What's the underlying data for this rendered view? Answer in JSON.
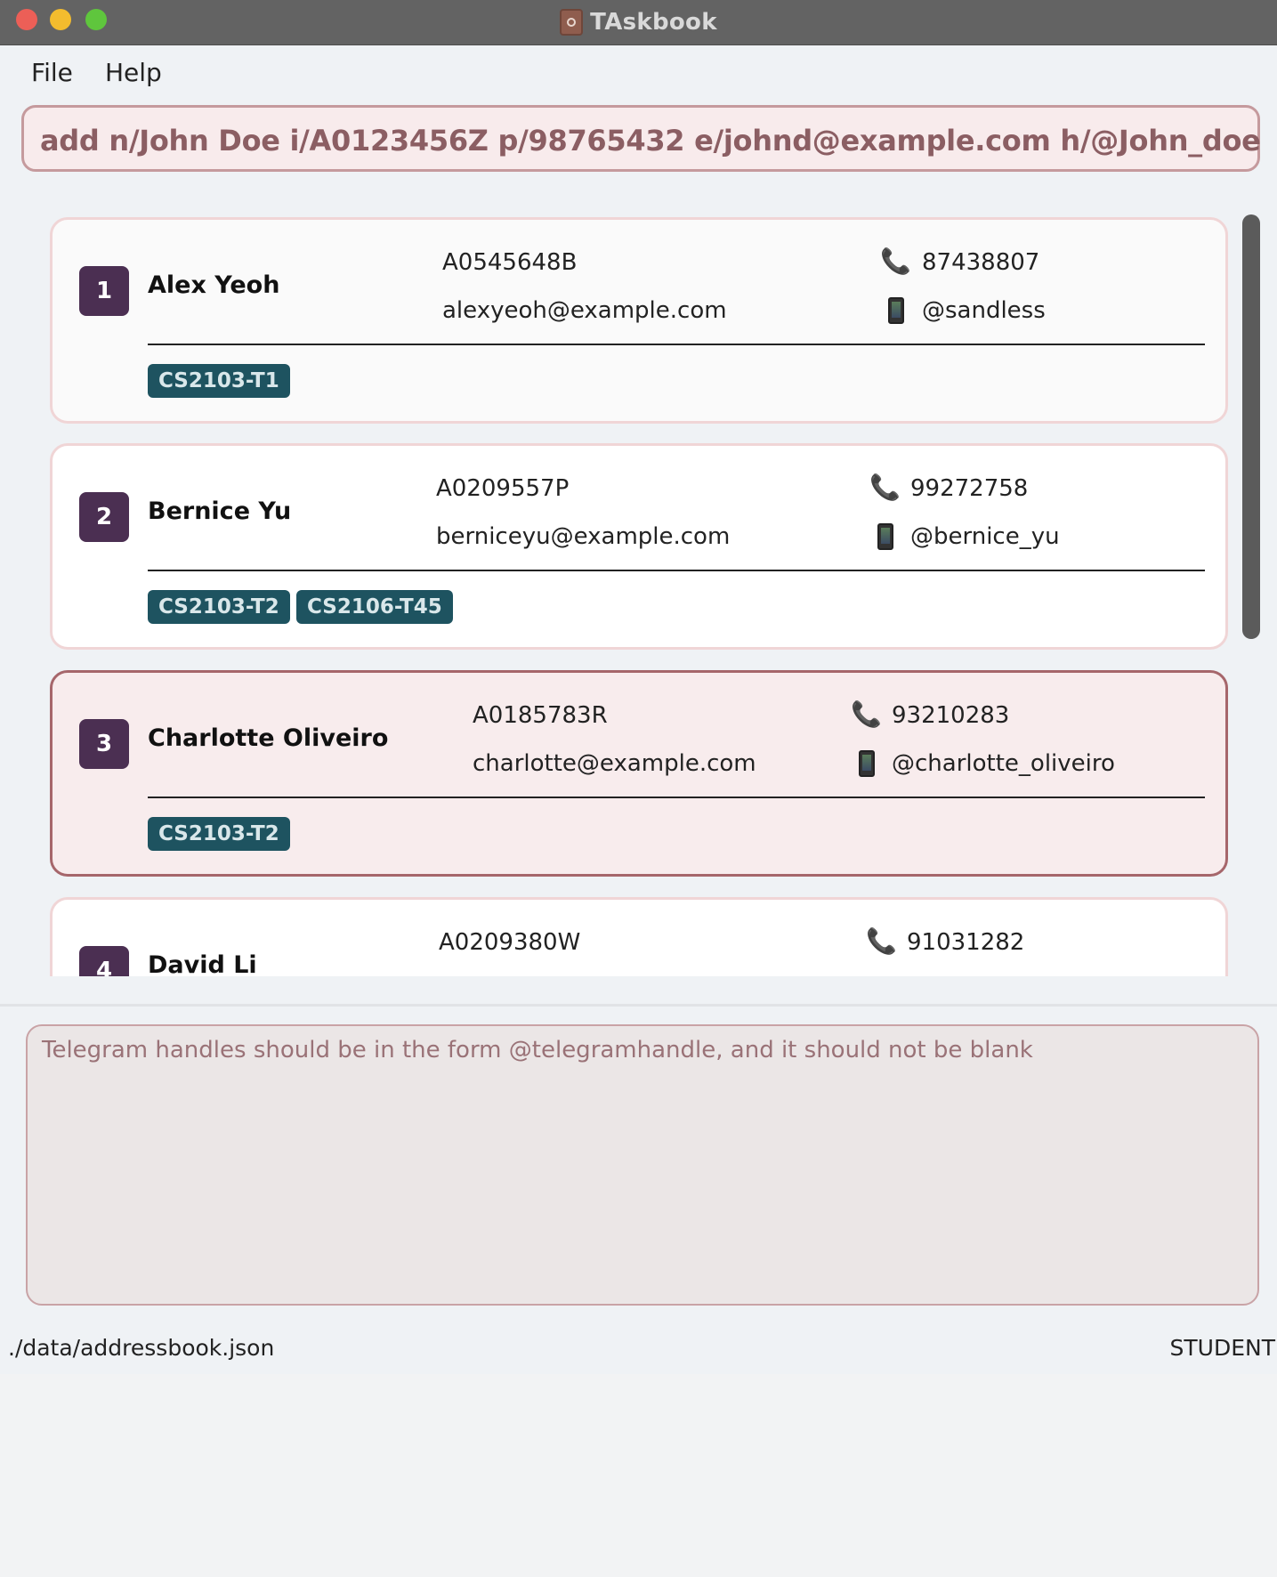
{
  "window": {
    "title": "TAskbook"
  },
  "menu": {
    "file": "File",
    "help": "Help"
  },
  "command": {
    "text": "add n/John Doe i/A0123456Z p/98765432 e/johnd@example.com h/@John_doe"
  },
  "persons": [
    {
      "index": "1",
      "name": "Alex Yeoh",
      "id": "A0545648B",
      "email": "alexyeoh@example.com",
      "phone": "87438807",
      "telegram": "@sandless",
      "tags": [
        "CS2103-T1"
      ]
    },
    {
      "index": "2",
      "name": "Bernice Yu",
      "id": "A0209557P",
      "email": "berniceyu@example.com",
      "phone": "99272758",
      "telegram": "@bernice_yu",
      "tags": [
        "CS2103-T2",
        "CS2106-T45"
      ]
    },
    {
      "index": "3",
      "name": "Charlotte Oliveiro",
      "id": "A0185783R",
      "email": "charlotte@example.com",
      "phone": "93210283",
      "telegram": "@charlotte_oliveiro",
      "tags": [
        "CS2103-T2"
      ]
    },
    {
      "index": "4",
      "name": "David Li",
      "id": "A0209380W",
      "phone": "91031282"
    }
  ],
  "result": {
    "text": "Telegram handles should be in the form @telegramhandle, and it should not be blank"
  },
  "status": {
    "file_path": "./data/addressbook.json",
    "mode": "STUDENT"
  },
  "icons": {
    "phone": "phone-icon",
    "telegram": "mobile-phone-icon",
    "app": "address-book-icon"
  },
  "colors": {
    "index_badge": "#4b2f52",
    "tag": "#1e5360",
    "selected_border": "#a6666b",
    "command_border": "#c59a9d"
  }
}
